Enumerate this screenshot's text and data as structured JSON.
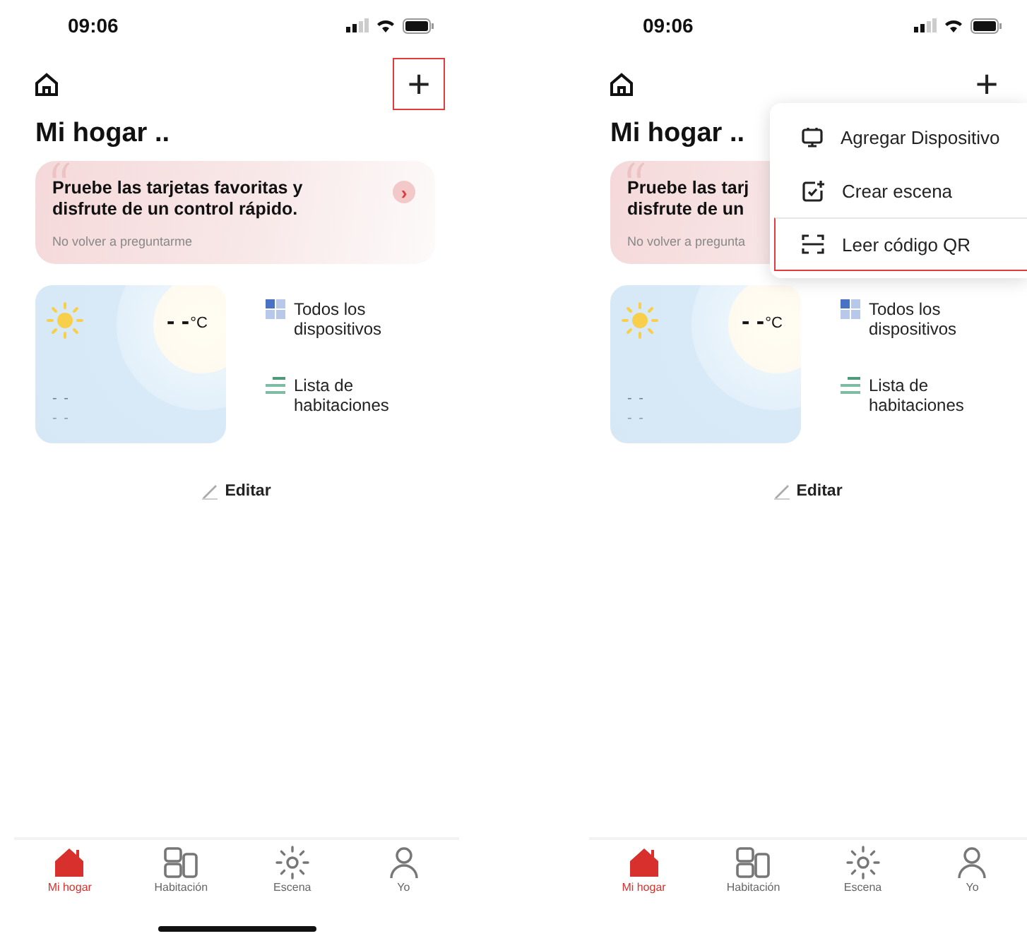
{
  "screens": [
    {
      "status_bar": {
        "time": "09:06"
      },
      "add_button": {
        "label": "+",
        "highlighted": true
      },
      "title": "Mi hogar ..",
      "banner": {
        "title_lines": [
          "Pruebe las tarjetas favoritas y",
          "disfrute de un control rápido."
        ],
        "dismiss": "No volver a preguntarme",
        "arrow": "›"
      },
      "weather": {
        "temperature": "- -",
        "unit": "°C",
        "line_1": "- -",
        "line_2": "- -"
      },
      "shortcuts": [
        {
          "kind": "grid",
          "label_lines": [
            "Todos los",
            "dispositivos"
          ]
        },
        {
          "kind": "list",
          "label_lines": [
            "Lista de",
            "habitaciones"
          ]
        }
      ],
      "edit": "Editar",
      "tabs": [
        {
          "kind": "home",
          "label": "Mi hogar",
          "selected": true
        },
        {
          "kind": "rooms",
          "label": "Habitación",
          "selected": false
        },
        {
          "kind": "scene",
          "label": "Escena",
          "selected": false
        },
        {
          "kind": "me",
          "label": "Yo",
          "selected": false
        }
      ],
      "home_indicator": true
    },
    {
      "status_bar": {
        "time": "09:06"
      },
      "add_button": {
        "label": "+",
        "highlighted": false
      },
      "title": "Mi hogar ..",
      "banner": {
        "title_lines": [
          "Pruebe las tarj",
          "disfrute de un"
        ],
        "dismiss": "No volver a pregunta"
      },
      "weather": {
        "temperature": "- -",
        "unit": "°C",
        "line_1": "- -",
        "line_2": "- -"
      },
      "shortcuts": [
        {
          "kind": "grid",
          "label_lines": [
            "Todos los",
            "dispositivos"
          ]
        },
        {
          "kind": "list",
          "label_lines": [
            "Lista de",
            "habitaciones"
          ]
        }
      ],
      "edit": "Editar",
      "tabs": [
        {
          "kind": "home",
          "label": "Mi hogar",
          "selected": true
        },
        {
          "kind": "rooms",
          "label": "Habitación",
          "selected": false
        },
        {
          "kind": "scene",
          "label": "Escena",
          "selected": false
        },
        {
          "kind": "me",
          "label": "Yo",
          "selected": false
        }
      ],
      "home_indicator": false,
      "menu": {
        "items": [
          {
            "kind": "device",
            "label": "Agregar Dispositivo",
            "highlighted": false
          },
          {
            "kind": "scene",
            "label": "Crear escena",
            "highlighted": false
          },
          {
            "kind": "qr",
            "label": "Leer código QR",
            "highlighted": true
          }
        ]
      }
    }
  ]
}
